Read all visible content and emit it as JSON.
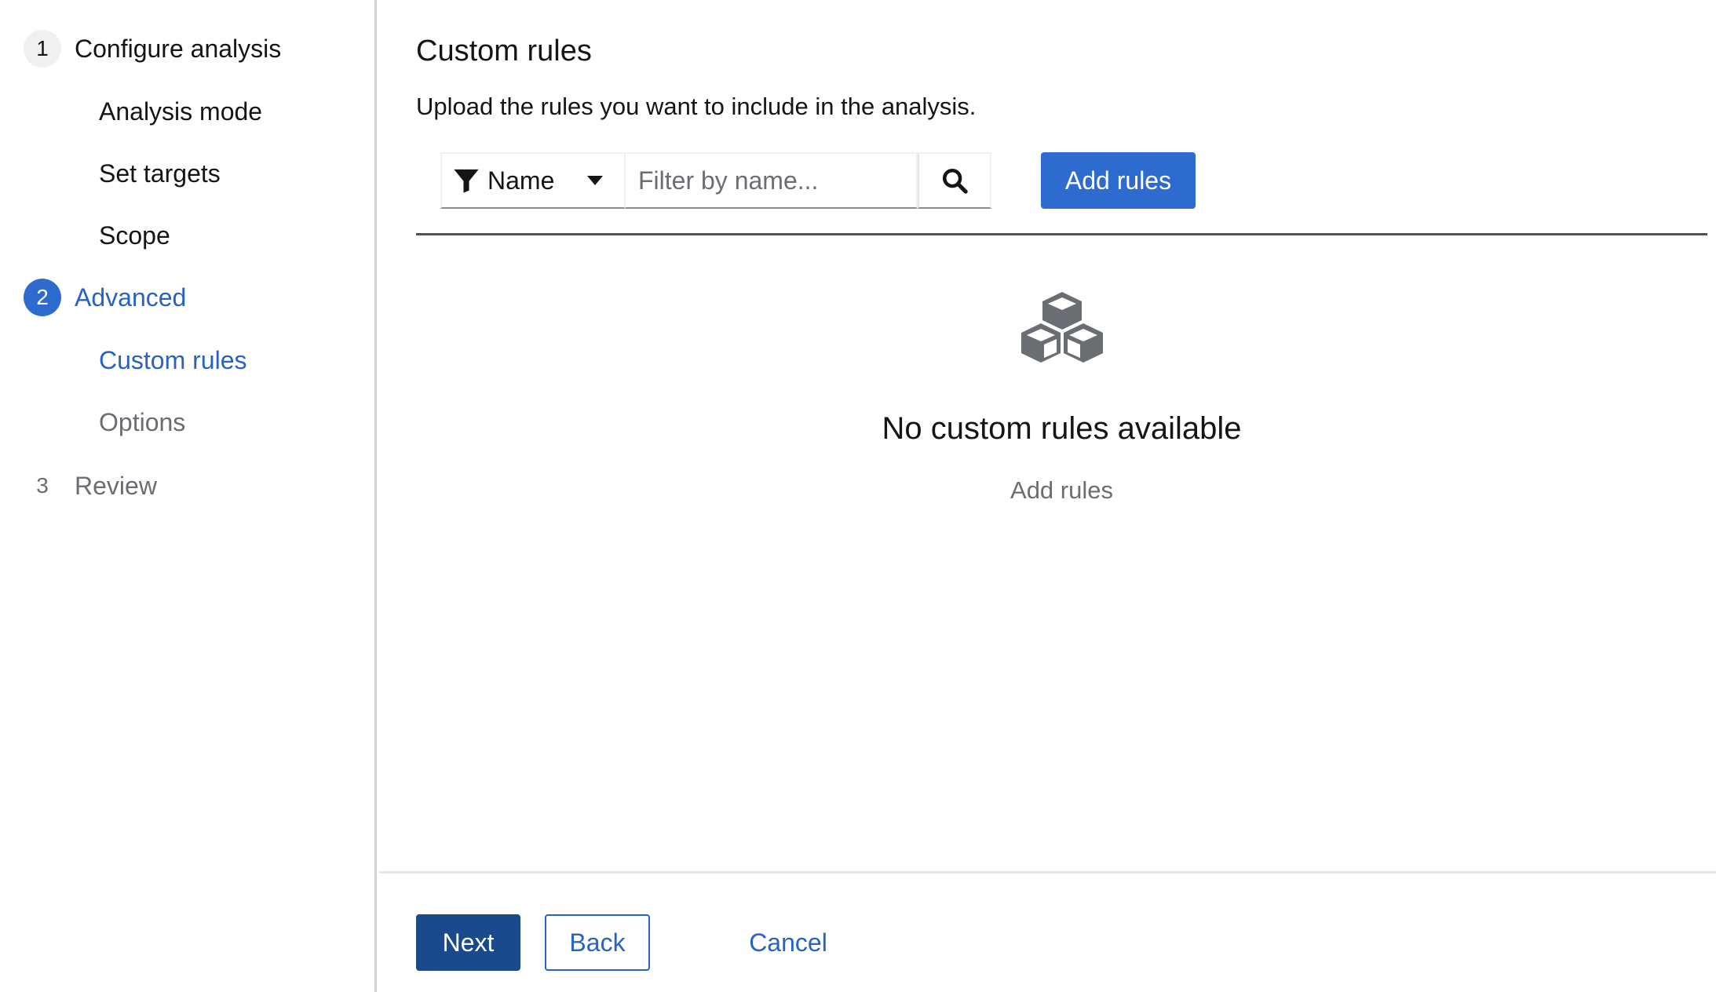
{
  "sidebar": {
    "steps": [
      {
        "number": "1",
        "label": "Configure analysis"
      },
      {
        "number": "2",
        "label": "Advanced"
      },
      {
        "number": "3",
        "label": "Review"
      }
    ],
    "substeps": [
      {
        "label": "Analysis mode"
      },
      {
        "label": "Set targets"
      },
      {
        "label": "Scope"
      },
      {
        "label": "Custom rules"
      },
      {
        "label": "Options"
      }
    ],
    "current_step": "Advanced",
    "current_substep": "Custom rules"
  },
  "main": {
    "title": "Custom rules",
    "description": "Upload the rules you want to include in the analysis.",
    "toolbar": {
      "filter_label": "Name",
      "filter_icon": "filter-icon",
      "search_placeholder": "Filter by name...",
      "search_icon": "search-icon",
      "add_rules_label": "Add rules"
    },
    "empty_state": {
      "icon": "cubes-icon",
      "title": "No custom rules available",
      "link": "Add rules"
    }
  },
  "footer": {
    "next_label": "Next",
    "back_label": "Back",
    "cancel_label": "Cancel"
  },
  "colors": {
    "primary": "#2d6bcf",
    "primary_dark": "#1b4a8c",
    "link": "#2762c4",
    "muted": "#6a6e73"
  }
}
